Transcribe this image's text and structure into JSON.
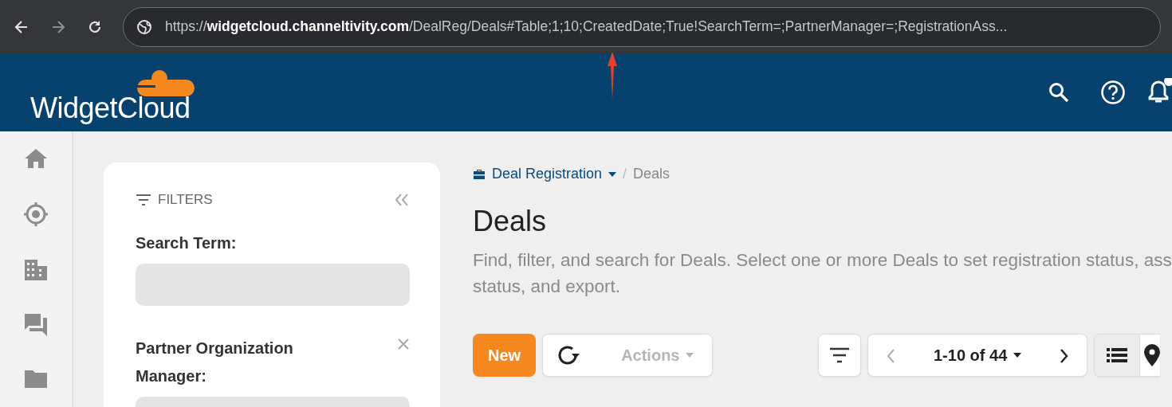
{
  "browser": {
    "url": "https://**widgetcloud.channeltivity.com**/DealReg/Deals#Table;1;10;CreatedDate;True!SearchTerm=;PartnerManager=;RegistrationAss..."
  },
  "header": {
    "logo_text": "WidgetCloud"
  },
  "filters": {
    "title": "FILTERS",
    "fields": [
      {
        "label": "Search Term:",
        "clearable": false
      },
      {
        "label": "Partner Organization Manager:",
        "clearable": true
      }
    ]
  },
  "breadcrumb_separator": "/",
  "breadcrumb": [
    {
      "label": "Deal Registration",
      "dropdown": true
    },
    {
      "label": "Deals",
      "dropdown": false
    }
  ],
  "title": "Deals",
  "description_lines": [
    "Find, filter, and search for Deals. Select one or more Deals to set registration status, ass",
    "status, and export."
  ],
  "toolbar": {
    "new_button": "New",
    "actions": {
      "label": "Actions",
      "disabled": true
    },
    "pager": "1-10 of 44",
    "views": [
      {
        "kind": "list",
        "selected": true
      },
      {
        "kind": "map",
        "selected": false
      }
    ]
  }
}
